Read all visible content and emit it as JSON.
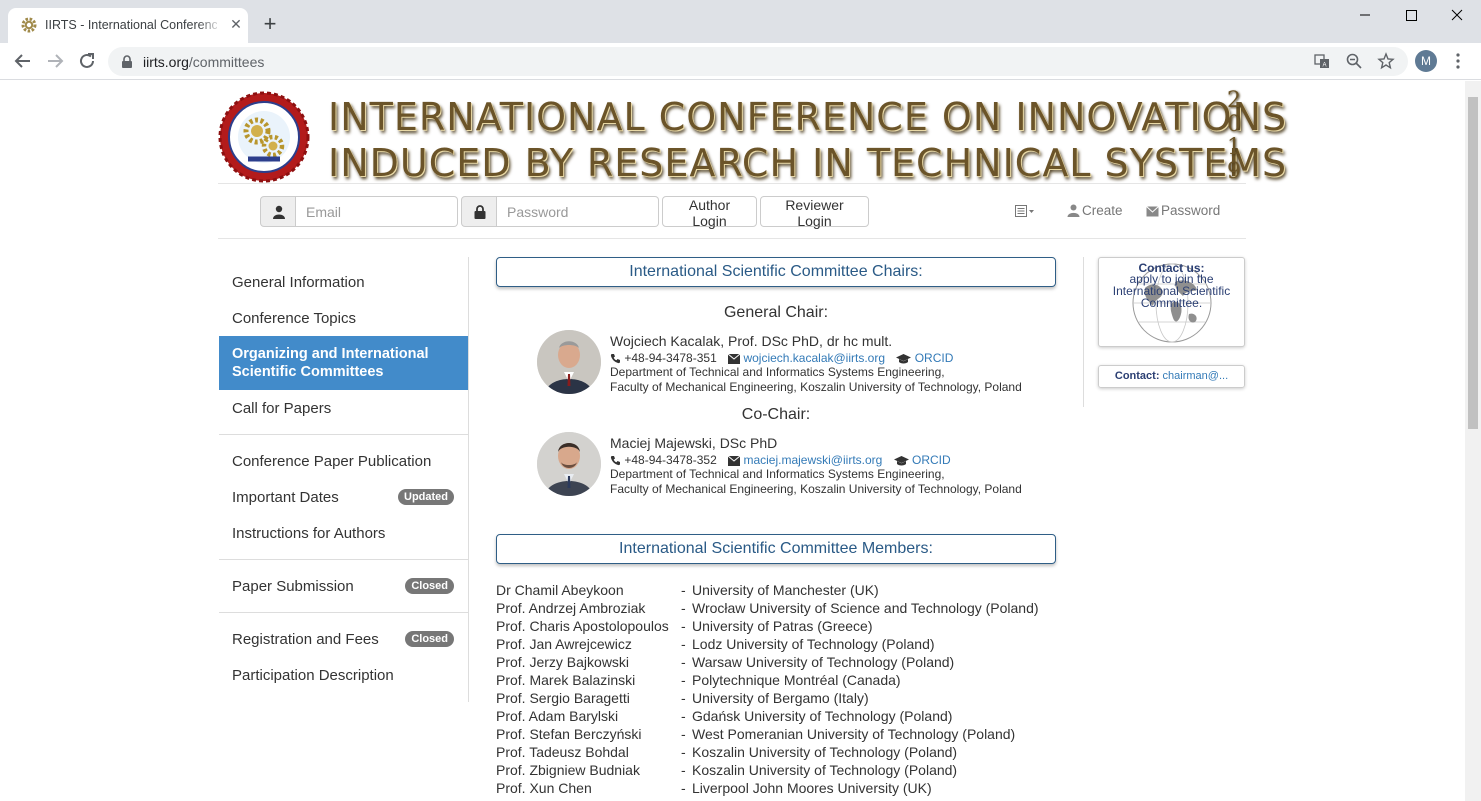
{
  "browser": {
    "tab_title": "IIRTS - International Conference on Innovations Induced by Research",
    "url_host": "iirts.org",
    "url_path": "/committees",
    "profile_initial": "M"
  },
  "banner": {
    "line1": "INTERNATIONAL CONFERENCE ON INNOVATIONS",
    "line2": "INDUCED BY RESEARCH IN TECHNICAL SYSTEMS",
    "year": [
      "2",
      "0",
      "1",
      "9"
    ],
    "logo_alt": "Innovations Induced by Research Conference logo"
  },
  "login": {
    "email_placeholder": "Email",
    "password_placeholder": "Password",
    "author_login": "Author Login",
    "reviewer_login": "Reviewer Login",
    "create": "Create",
    "password_link": "Password"
  },
  "sidebar": {
    "items": [
      {
        "label": "General Information"
      },
      {
        "label": "Conference Topics"
      },
      {
        "label": "Organizing and International Scientific Committees",
        "active": true
      },
      {
        "label": "Call for Papers"
      },
      {
        "label": "Conference Paper Publication"
      },
      {
        "label": "Important Dates",
        "badge": "Updated"
      },
      {
        "label": "Instructions for Authors"
      },
      {
        "label": "Paper Submission",
        "badge": "Closed"
      },
      {
        "label": "Registration and Fees",
        "badge": "Closed"
      },
      {
        "label": "Participation Description"
      }
    ]
  },
  "chairs_section": {
    "title": "International Scientific Committee Chairs:",
    "general_chair_label": "General Chair:",
    "co_chair_label": "Co-Chair:",
    "chairs": [
      {
        "name": "Wojciech Kacalak, Prof. DSc PhD, dr hc mult.",
        "phone": "+48-94-3478-351",
        "email": "wojciech.kacalak@iirts.org",
        "orcid": "ORCID",
        "dept": "Department of Technical and Informatics Systems Engineering,",
        "faculty": "Faculty of Mechanical Engineering, Koszalin University of Technology, Poland"
      },
      {
        "name": "Maciej Majewski, DSc PhD",
        "phone": "+48-94-3478-352",
        "email": "maciej.majewski@iirts.org",
        "orcid": "ORCID",
        "dept": "Department of Technical and Informatics Systems Engineering,",
        "faculty": "Faculty of Mechanical Engineering, Koszalin University of Technology, Poland"
      }
    ]
  },
  "members_section": {
    "title": "International Scientific Committee Members:",
    "members": [
      {
        "name": "Dr Chamil Abeykoon",
        "affiliation": "University of Manchester (UK)"
      },
      {
        "name": "Prof. Andrzej Ambroziak",
        "affiliation": "Wrocław University of Science and Technology (Poland)"
      },
      {
        "name": "Prof. Charis Apostolopoulos",
        "affiliation": "University of Patras (Greece)"
      },
      {
        "name": "Prof. Jan Awrejcewicz",
        "affiliation": "Lodz University of Technology (Poland)"
      },
      {
        "name": "Prof. Jerzy Bajkowski",
        "affiliation": "Warsaw University of Technology (Poland)"
      },
      {
        "name": "Prof. Marek Balazinski",
        "affiliation": "Polytechnique Montréal (Canada)"
      },
      {
        "name": "Prof. Sergio Baragetti",
        "affiliation": "University of Bergamo (Italy)"
      },
      {
        "name": "Prof. Adam Barylski",
        "affiliation": "Gdańsk University of Technology (Poland)"
      },
      {
        "name": "Prof. Stefan Berczyński",
        "affiliation": "West Pomeranian University of Technology (Poland)"
      },
      {
        "name": "Prof. Tadeusz Bohdal",
        "affiliation": "Koszalin University of Technology (Poland)"
      },
      {
        "name": "Prof. Zbigniew Budniak",
        "affiliation": "Koszalin University of Technology (Poland)"
      },
      {
        "name": "Prof. Xun Chen",
        "affiliation": "Liverpool John Moores University (UK)"
      }
    ],
    "dash": "-"
  },
  "contact": {
    "title": "Contact us:",
    "text": "apply to join the International Scientific Committee.",
    "mail_label": "Contact:",
    "mail_value": "chairman@..."
  }
}
